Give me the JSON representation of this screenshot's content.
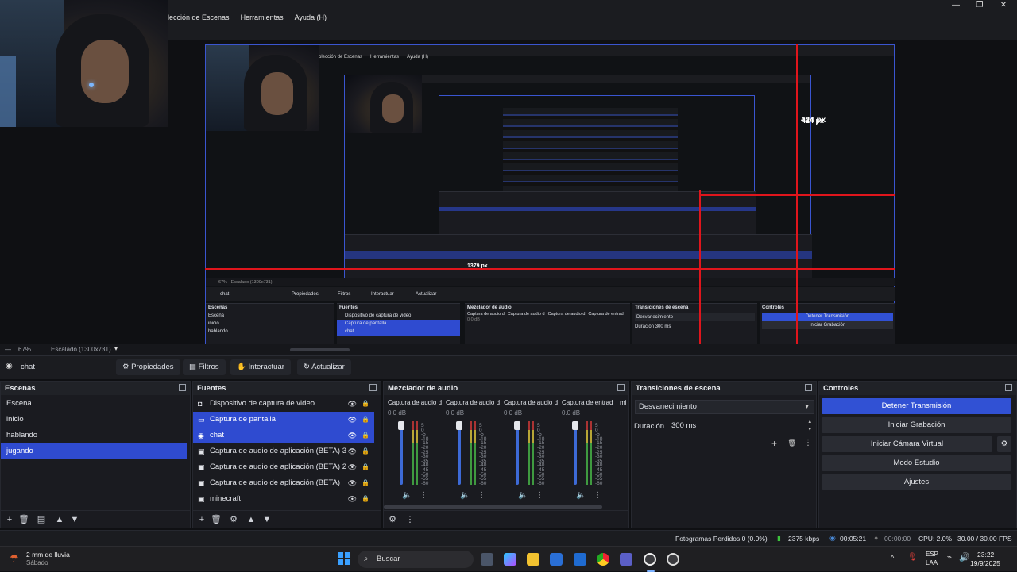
{
  "menu": [
    "olección de Escenas",
    "Herramientas",
    "Ayuda (H)"
  ],
  "window_controls": [
    "—",
    "❐",
    "✕"
  ],
  "preview": {
    "nested_menu": [
      "olección de Escenas",
      "Herramientas",
      "Ayuda (H)"
    ],
    "px_labels": [
      "424 px",
      "1379 px",
      "424 px"
    ],
    "nested_toolbar": {
      "source": "chat",
      "buttons": [
        "Propiedades",
        "Filtros",
        "Interactuar",
        "Actualizar"
      ]
    },
    "nested_scenebar": {
      "zoom": "67%",
      "scaled": "Escalado (1300x731)"
    },
    "nested_docks": {
      "scenes": {
        "title": "Escenas",
        "items": [
          "Escena",
          "inicio",
          "hablando"
        ]
      },
      "sources": {
        "title": "Fuentes",
        "items": [
          "Dispositivo de captura de video",
          "Captura de pantalla",
          "chat"
        ]
      },
      "mixer": {
        "title": "Mezclador de audio",
        "channels": [
          "Captura de audio d",
          "Captura de audio d",
          "Captura de audio d",
          "Captura de entrad"
        ],
        "db": "0.0 dB"
      },
      "transitions": {
        "title": "Transiciones de escena",
        "selected": "Desvanecimiento",
        "duration_label": "Duración",
        "duration": "300 ms"
      },
      "controls": {
        "title": "Controles",
        "buttons": [
          "Detener Transmisión",
          "Iniciar Grabación"
        ]
      }
    }
  },
  "scenebar": {
    "zoom": "67%",
    "scaled": "Escalado (1300x731)"
  },
  "source_toolbar": {
    "source_name": "chat",
    "buttons": [
      "Propiedades",
      "Filtros",
      "Interactuar",
      "Actualizar"
    ]
  },
  "scenes": {
    "title": "Escenas",
    "items": [
      "Escena",
      "inicio",
      "hablando",
      "jugando"
    ],
    "selected_index": 3
  },
  "sources": {
    "title": "Fuentes",
    "items": [
      {
        "name": "Dispositivo de captura de video",
        "icon": "camera-icon",
        "selected": false
      },
      {
        "name": "Captura de pantalla",
        "icon": "monitor-icon",
        "selected": true
      },
      {
        "name": "chat",
        "icon": "globe-icon",
        "selected": true
      },
      {
        "name": "Captura de audio de aplicación (BETA) 3",
        "icon": "app-audio-icon",
        "selected": false
      },
      {
        "name": "Captura de audio de aplicación (BETA) 2",
        "icon": "app-audio-icon",
        "selected": false
      },
      {
        "name": "Captura de audio de aplicación (BETA)",
        "icon": "app-audio-icon",
        "selected": false
      },
      {
        "name": "minecraft",
        "icon": "app-audio-icon",
        "selected": false
      }
    ]
  },
  "mixer": {
    "title": "Mezclador de audio",
    "channels": [
      {
        "name": "Captura de audio d",
        "db": "0.0 dB"
      },
      {
        "name": "Captura de audio d",
        "db": "0.0 dB"
      },
      {
        "name": "Captura de audio d",
        "db": "0.0 dB"
      },
      {
        "name": "Captura de entrad",
        "db": "0.0 dB"
      },
      {
        "name": "mi",
        "db": ""
      }
    ],
    "scale": [
      "5",
      "0",
      "-5",
      "-10",
      "-15",
      "-20",
      "-25",
      "-30",
      "-35",
      "-40",
      "-45",
      "-50",
      "-55",
      "-60"
    ]
  },
  "transitions": {
    "title": "Transiciones de escena",
    "selected": "Desvanecimiento",
    "duration_label": "Duración",
    "duration_value": "300 ms"
  },
  "controls": {
    "title": "Controles",
    "buttons": [
      "Detener Transmisión",
      "Iniciar Grabación",
      "Iniciar Cámara Virtual",
      "Modo Estudio",
      "Ajustes"
    ]
  },
  "status": {
    "dropped": "Fotogramas Perdidos 0 (0.0%)",
    "bitrate": "2375 kbps",
    "stream_time": "00:05:21",
    "rec_time": "00:00:00",
    "cpu": "CPU: 2.0%",
    "fps": "30.00 / 30.00 FPS"
  },
  "taskbar": {
    "weather_temp": "2 mm de lluvia",
    "weather_day": "Sábado",
    "search": "Buscar",
    "lang": "ESP",
    "lang2": "LAA",
    "time": "23:22",
    "date": "19/9/2025"
  },
  "colors": {
    "accent": "#2f4bd0",
    "primary_button": "#3151d4",
    "red_guides": "#e0151c",
    "bitrate_ok": "#3cc43c"
  }
}
